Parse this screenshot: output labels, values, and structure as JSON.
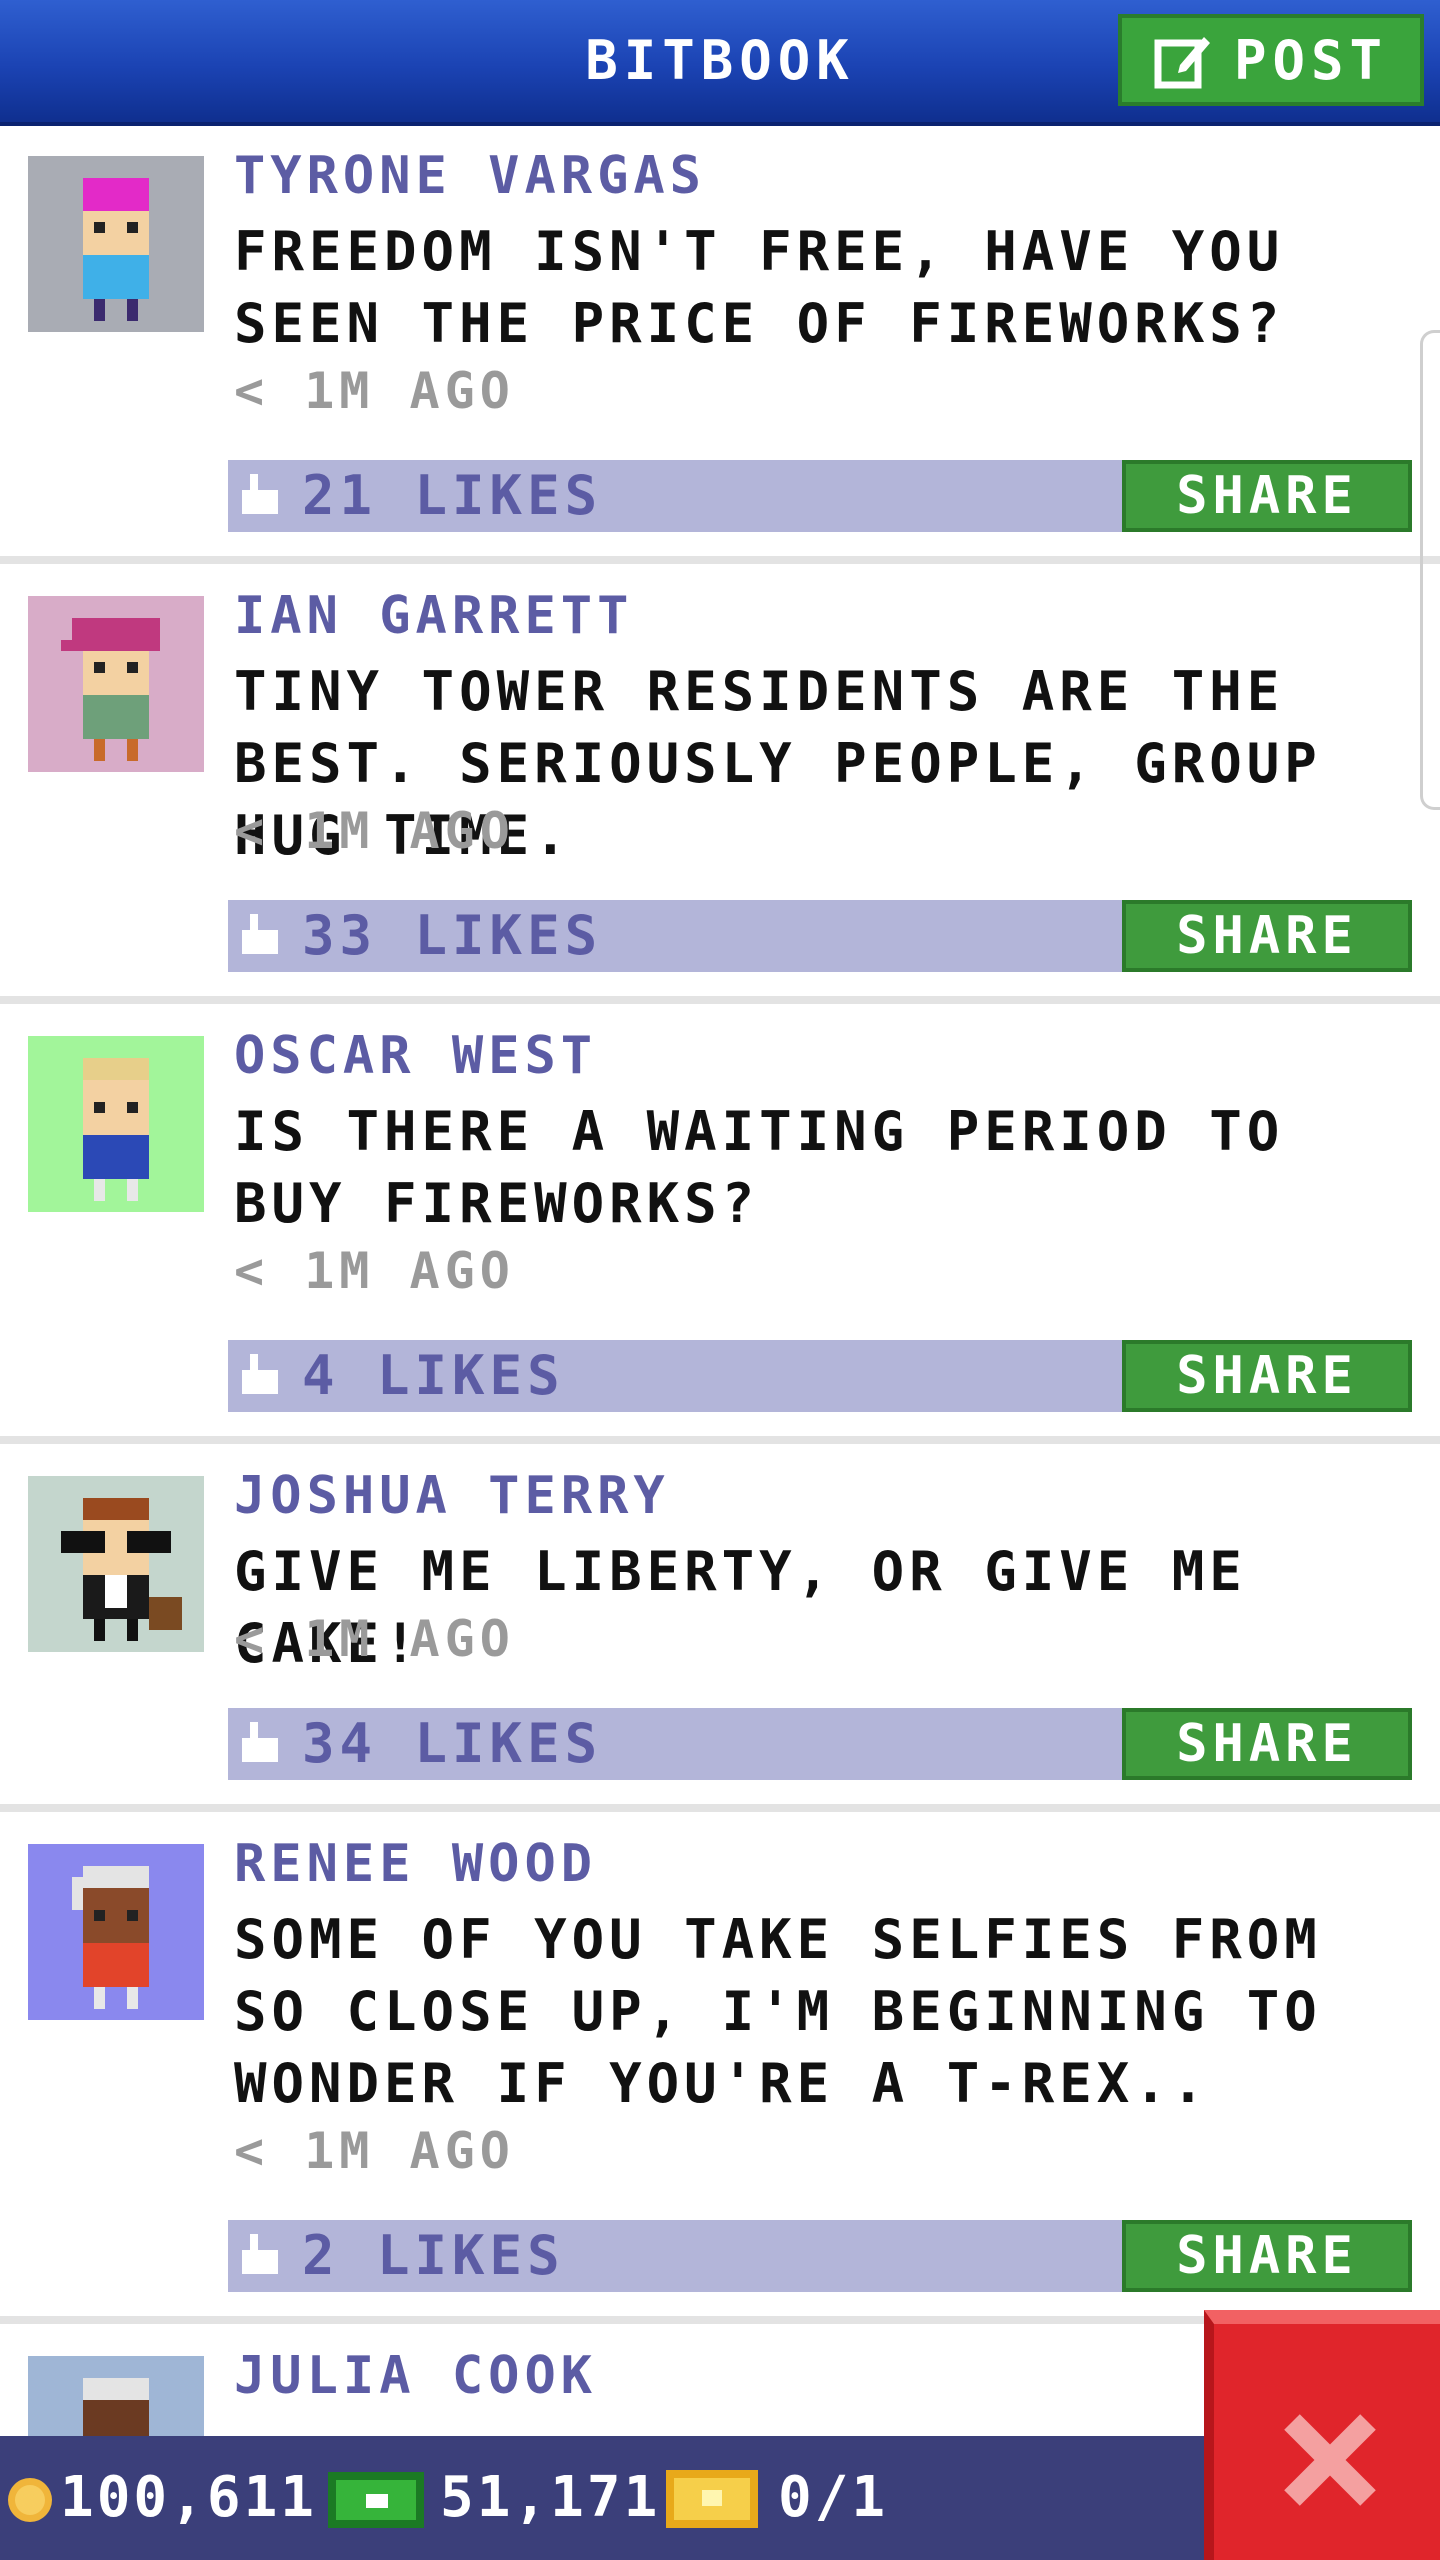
{
  "header": {
    "title": "BITBOOK",
    "post_label": "POST",
    "post_icon": "compose-icon",
    "color": "#1b43b3"
  },
  "posts": [
    {
      "author": "TYRONE VARGAS",
      "text": "FREEDOM ISN'T FREE, HAVE YOU SEEN THE PRICE OF FIREWORKS?",
      "time": "< 1M AGO",
      "likes": "21 LIKES",
      "share": "SHARE",
      "avatar_bg": "#a9acb4"
    },
    {
      "author": "IAN GARRETT",
      "text": "TINY TOWER RESIDENTS ARE THE BEST. SERIOUSLY PEOPLE, GROUP HUG TIME.",
      "time": "< 1M AGO",
      "likes": "33 LIKES",
      "share": "SHARE",
      "avatar_bg": "#d8acc8"
    },
    {
      "author": "OSCAR WEST",
      "text": "IS THERE A WAITING PERIOD TO BUY FIREWORKS?",
      "time": "< 1M AGO",
      "likes": "4 LIKES",
      "share": "SHARE",
      "avatar_bg": "#a2f59a"
    },
    {
      "author": "JOSHUA TERRY",
      "text": "GIVE ME LIBERTY, OR GIVE ME CAKE!",
      "time": "< 1M AGO",
      "likes": "34 LIKES",
      "share": "SHARE",
      "avatar_bg": "#c4d6cd"
    },
    {
      "author": "RENEE WOOD",
      "text": "SOME OF YOU TAKE SELFIES FROM SO CLOSE UP, I'M BEGINNING TO WONDER IF YOU'RE A T-REX..",
      "time": "< 1M AGO",
      "likes": "2 LIKES",
      "share": "SHARE",
      "avatar_bg": "#8a88ee"
    },
    {
      "author": "JULIA COOK",
      "avatar_bg": "#9fb6d6"
    }
  ],
  "bottom_bar": {
    "coins": "100,611",
    "bux": "51,171",
    "tickets": "0/1",
    "coin_icon": "coin-icon",
    "bux_icon": "bux-icon",
    "ticket_icon": "ticket-icon"
  },
  "close_icon": "close-icon"
}
